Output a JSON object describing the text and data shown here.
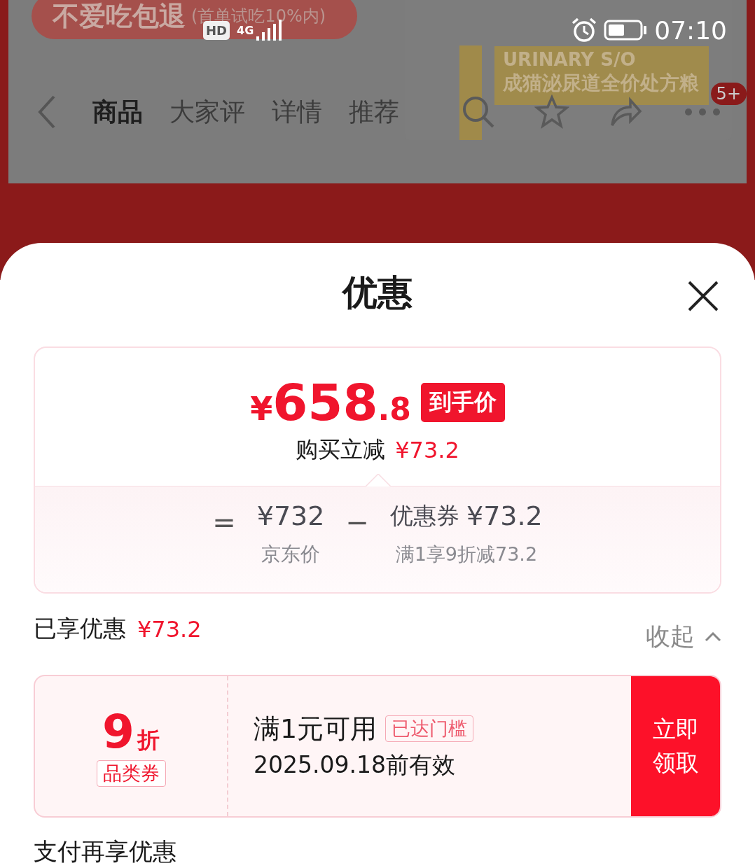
{
  "status_bar": {
    "hd": "HD",
    "network": "4G",
    "time": "07:10"
  },
  "background": {
    "promo": {
      "title": "不爱吃包退",
      "note": "(首单试吃10%内)"
    },
    "product_label": {
      "line1": "URINARY S/O",
      "line2": "成猫泌尿道全价处方粮"
    },
    "cart_badge": "5+",
    "tabs": [
      {
        "label": "商品",
        "selected": true
      },
      {
        "label": "大家评",
        "selected": false
      },
      {
        "label": "详情",
        "selected": false
      },
      {
        "label": "推荐",
        "selected": false
      }
    ]
  },
  "sheet": {
    "title": "优惠",
    "price": {
      "currency": "¥",
      "integer": "658",
      "decimal": ".8",
      "tag": "到手价",
      "saving_label": "购买立减",
      "saving": "¥73.2"
    },
    "breakdown": {
      "equals": "=",
      "jd_price": "¥732",
      "jd_label": "京东价",
      "minus": "−",
      "coupon_label": "优惠券",
      "coupon_amount": "¥73.2",
      "coupon_rule": "满1享9折减73.2"
    },
    "enjoyed": {
      "label": "已享优惠",
      "amount": "¥73.2"
    },
    "collapse": "收起",
    "coupons": [
      {
        "discount": "9",
        "unit": "折",
        "type": "品类券",
        "condition": "满1元可用",
        "status_tag": "已达门槛",
        "expiry": "2025.09.18前有效",
        "action": "立即领取"
      }
    ],
    "next_section": "支付再享优惠"
  }
}
